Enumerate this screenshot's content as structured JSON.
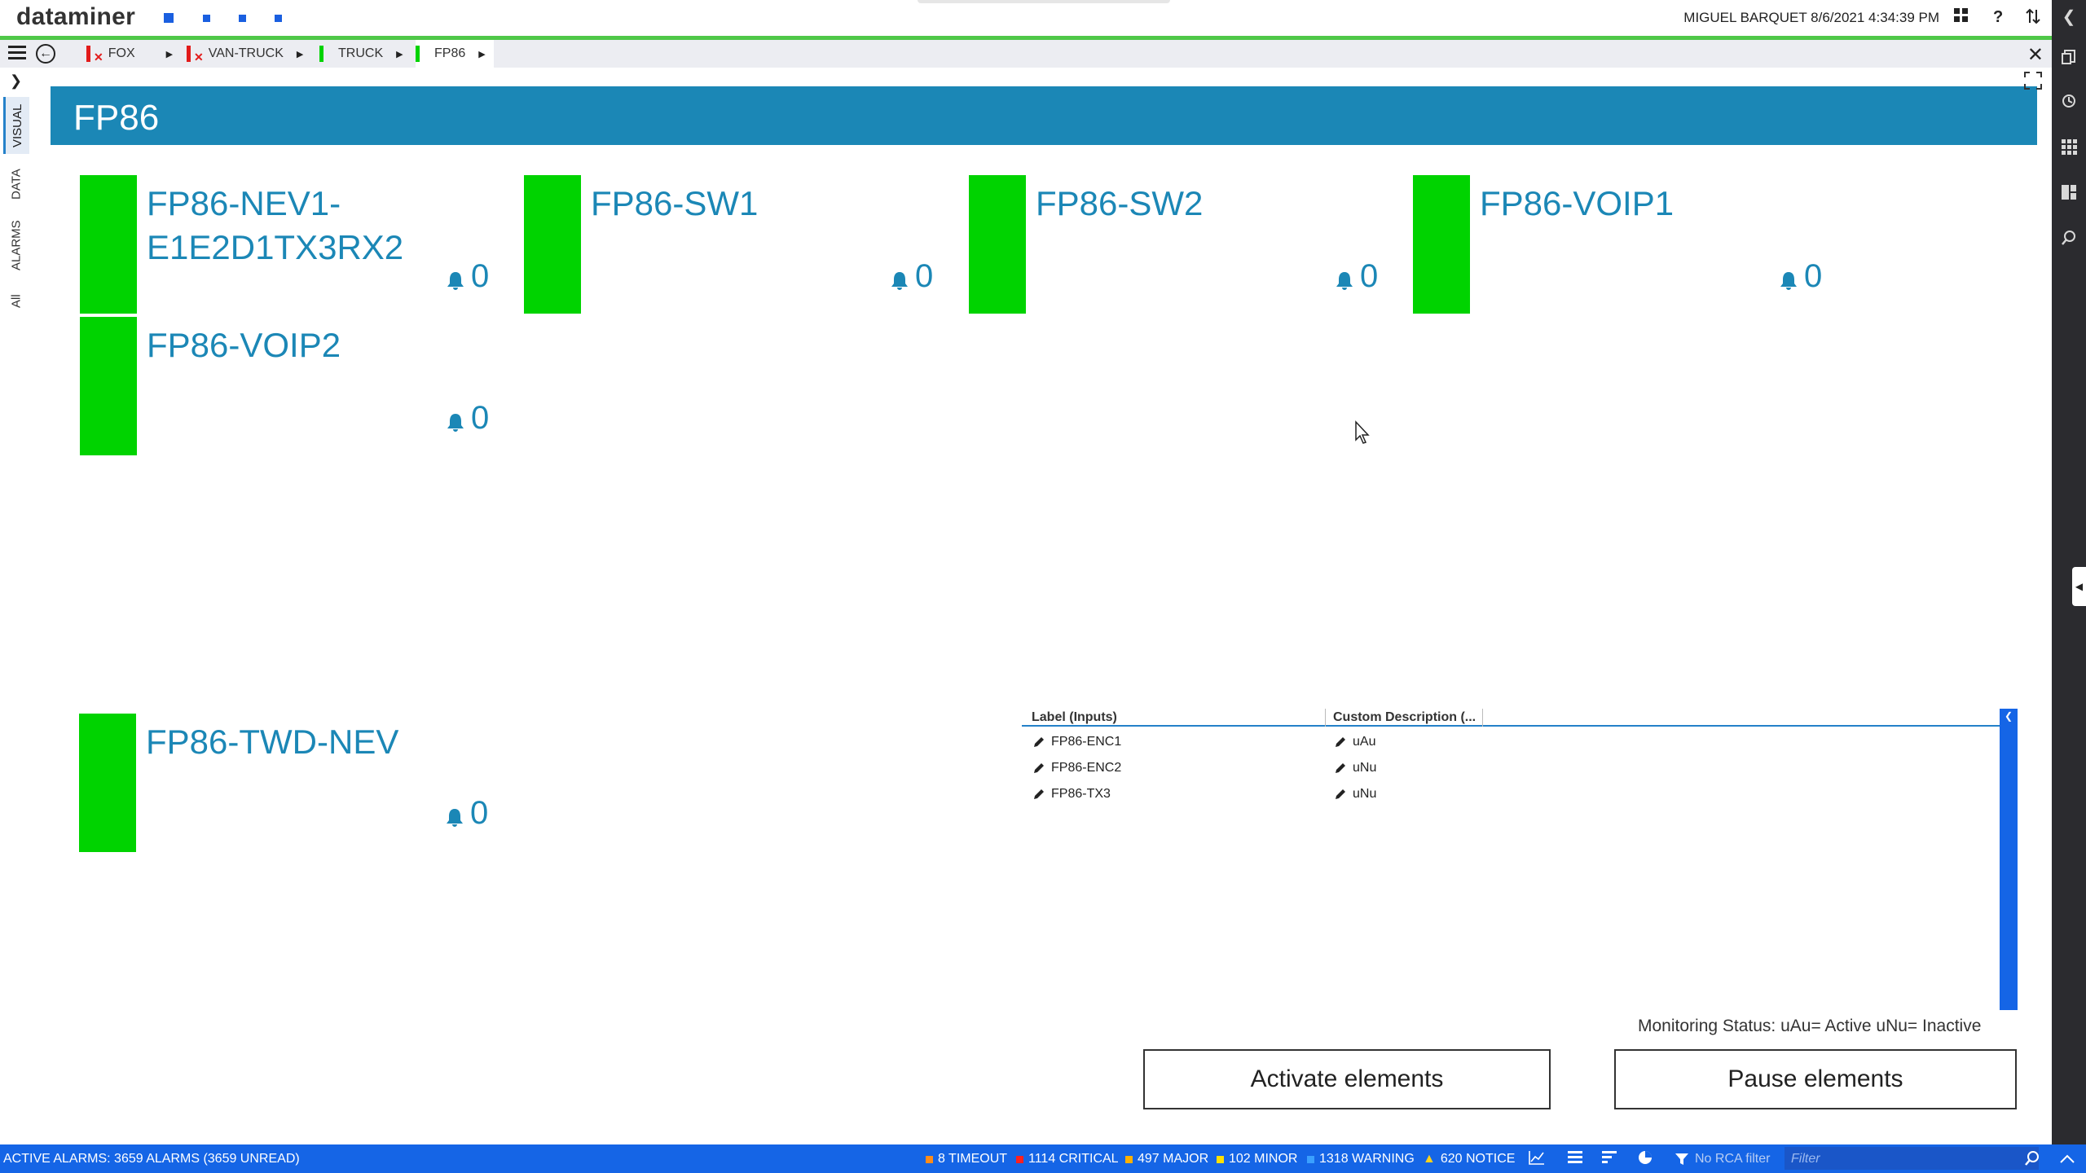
{
  "app": {
    "logo": "dataminer",
    "user_time": "MIGUEL BARQUET 8/6/2021 4:34:39 PM",
    "help": "?"
  },
  "breadcrumbs": [
    {
      "label": "FOX",
      "status_color": "#e21b1b",
      "error": true
    },
    {
      "label": "VAN-TRUCK",
      "status_color": "#e21b1b",
      "error": true
    },
    {
      "label": "TRUCK",
      "status_color": "#00d300",
      "error": false
    },
    {
      "label": "FP86",
      "status_color": "#00d300",
      "error": false
    }
  ],
  "side_tabs": [
    "VISUAL",
    "DATA",
    "ALARMS",
    "All"
  ],
  "view": {
    "title": "FP86",
    "header_color": "#1b87b6",
    "elements": [
      {
        "name": "FP86-NEV1-E1E2D1TX3RX2",
        "alarms": "0",
        "status_color": "#00d300"
      },
      {
        "name": "FP86-SW1",
        "alarms": "0",
        "status_color": "#00d300"
      },
      {
        "name": "FP86-SW2",
        "alarms": "0",
        "status_color": "#00d300"
      },
      {
        "name": "FP86-VOIP1",
        "alarms": "0",
        "status_color": "#00d300"
      },
      {
        "name": "FP86-VOIP2",
        "alarms": "0",
        "status_color": "#00d300"
      },
      {
        "name": "FP86-TWD-NEV",
        "alarms": "0",
        "status_color": "#00d300"
      }
    ],
    "table": {
      "columns": [
        "Label (Inputs)",
        "Custom Description (..."
      ],
      "rows": [
        {
          "label": "FP86-ENC1",
          "desc": "uAu"
        },
        {
          "label": "FP86-ENC2",
          "desc": "uNu"
        },
        {
          "label": "FP86-TX3",
          "desc": "uNu"
        }
      ]
    },
    "monitoring_status": "Monitoring Status:   uAu= Active   uNu= Inactive",
    "activate_label": "Activate elements",
    "pause_label": "Pause elements"
  },
  "statusbar": {
    "active_alarms": "ACTIVE ALARMS: 3659 ALARMS (3659 UNREAD)",
    "counters": [
      {
        "label": "8 TIMEOUT",
        "color": "#ff8c1a"
      },
      {
        "label": "1114 CRITICAL",
        "color": "#ff2020"
      },
      {
        "label": "497 MAJOR",
        "color": "#ffb000"
      },
      {
        "label": "102 MINOR",
        "color": "#ffe000"
      },
      {
        "label": "1318 WARNING",
        "color": "#3aa0ff"
      },
      {
        "label": "620 NOTICE",
        "color": "#ffd21a"
      }
    ],
    "rca_filter": "No RCA filter",
    "filter_placeholder": "Filter"
  },
  "icons": [
    "hamburger-icon",
    "back-arrow-icon",
    "chevron-right-icon",
    "close-icon",
    "fullscreen-icon",
    "bell-icon",
    "pencil-icon",
    "grid-apps-icon",
    "help-icon",
    "sort-arrows-icon",
    "history-icon",
    "search-icon",
    "filter-funnel-icon"
  ]
}
